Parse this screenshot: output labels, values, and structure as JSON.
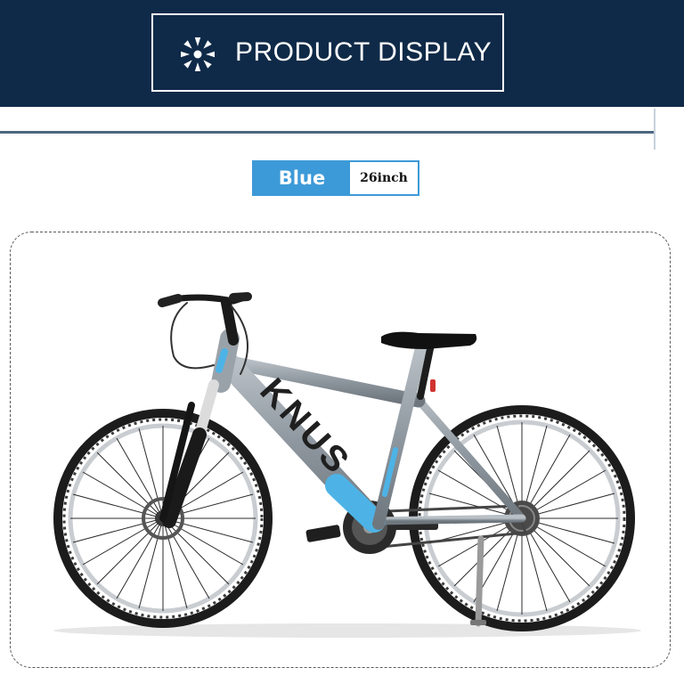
{
  "header": {
    "title": "PRODUCT DISPLAY",
    "icon": "snowflake-icon",
    "background_color": "#0f2a48"
  },
  "variant": {
    "color_label": "Blue",
    "size_label": "26inch",
    "accent_color": "#3d9ad8"
  },
  "product": {
    "image": "mountain-bike-photo",
    "frame_color": "#8e979f",
    "accent_color": "#4db3e6",
    "brand_text": "KNUS"
  }
}
